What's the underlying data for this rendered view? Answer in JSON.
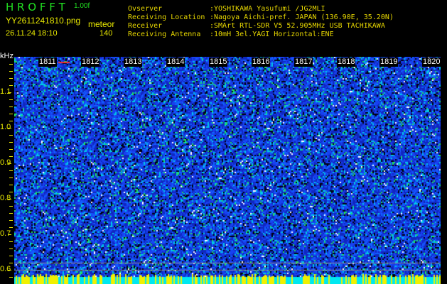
{
  "app": {
    "name": "H R O F F T",
    "version": "1.00f"
  },
  "file": {
    "name": "YY2611241810.png",
    "datetime": "26.11.24 18:10"
  },
  "detection": {
    "label": "meteor",
    "count": "140"
  },
  "info": [
    {
      "key": "Ovserver",
      "value": ":YOSHIKAWA Yasufumi /JG2MLI"
    },
    {
      "key": "Receiving Location",
      "value": ":Nagoya Aichi-pref. JAPAN (136.90E, 35.20N)"
    },
    {
      "key": "Receiver",
      "value": ":SMArt RTL-SDR V5 52.905MHz USB TACHIKAWA"
    },
    {
      "key": "Receiving Antenna",
      "value": ":10mH 3el.YAGI Horizontal:ENE"
    }
  ],
  "axis": {
    "unit": "kHz",
    "y_labels": [
      "1.1",
      "1.0",
      "0.9",
      "0.8",
      "0.7",
      "0.6"
    ],
    "time_labels": [
      "1811",
      "1812",
      "1813",
      "1814",
      "1815",
      "1816",
      "1817",
      "1818",
      "1819",
      "1820"
    ]
  },
  "colors": {
    "text_green": "#22e022",
    "text_yellow": "#e8e800",
    "noise_blue": "#1030e0",
    "noise_cyan": "#00e8f0",
    "meteor": "#ff3030"
  }
}
